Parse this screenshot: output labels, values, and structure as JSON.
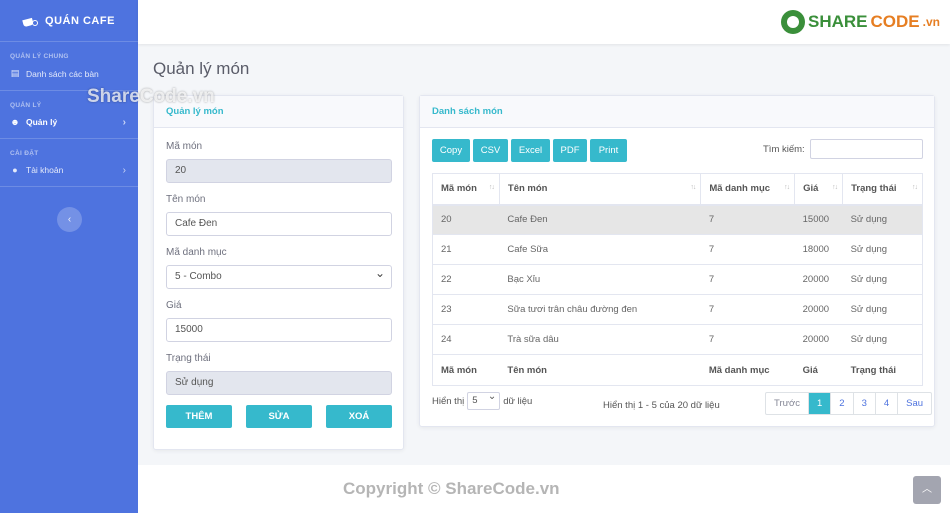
{
  "sidebar": {
    "brand": "QUÁN CAFE",
    "sections": [
      {
        "heading": "QUẢN LÝ CHUNG",
        "items": [
          {
            "label": "Danh sách các bàn",
            "icon": "table-icon"
          }
        ]
      },
      {
        "heading": "QUẢN LÝ",
        "items": [
          {
            "label": "Quản lý",
            "icon": "users-icon"
          }
        ]
      },
      {
        "heading": "CÀI ĐẶT",
        "items": [
          {
            "label": "Tài khoản",
            "icon": "user-icon"
          }
        ]
      }
    ]
  },
  "topbar": {
    "logo_share": "SHARE",
    "logo_code": "CODE",
    "logo_vn": ".vn"
  },
  "page": {
    "title": "Quản lý món"
  },
  "form": {
    "header": "Quản lý món",
    "ma_mon_label": "Mã món",
    "ma_mon_value": "20",
    "ten_mon_label": "Tên món",
    "ten_mon_value": "Cafe Đen",
    "ma_danh_muc_label": "Mã danh mục",
    "ma_danh_muc_value": "5 - Combo",
    "gia_label": "Giá",
    "gia_value": "15000",
    "trang_thai_label": "Trạng thái",
    "trang_thai_value": "Sử dụng",
    "btn_add": "THÊM",
    "btn_edit": "SỬA",
    "btn_delete": "XOÁ"
  },
  "list": {
    "header": "Danh sách món",
    "buttons": [
      "Copy",
      "CSV",
      "Excel",
      "PDF",
      "Print"
    ],
    "search_label": "Tìm kiếm:",
    "columns": [
      "Mã món",
      "Tên món",
      "Mã danh mục",
      "Giá",
      "Trạng thái"
    ],
    "rows": [
      [
        "20",
        "Cafe Đen",
        "7",
        "15000",
        "Sử dụng"
      ],
      [
        "21",
        "Cafe Sữa",
        "7",
        "18000",
        "Sử dụng"
      ],
      [
        "22",
        "Bạc Xỉu",
        "7",
        "20000",
        "Sử dụng"
      ],
      [
        "23",
        "Sữa tươi trân châu đường đen",
        "7",
        "20000",
        "Sử dụng"
      ],
      [
        "24",
        "Trà sữa dâu",
        "7",
        "20000",
        "Sử dụng"
      ]
    ],
    "length_prefix": "Hiển thị",
    "length_value": "5",
    "length_suffix": "dữ liệu",
    "info": "Hiển thị 1 - 5 của 20 dữ liệu",
    "pager": [
      "Trước",
      "1",
      "2",
      "3",
      "4",
      "Sau"
    ]
  },
  "footer": {
    "copyright": "Copyright © ShareCode.vn"
  },
  "watermark": "ShareCode.vn",
  "colors": {
    "sidebar": "#4e73df",
    "accent": "#36b9cc"
  }
}
